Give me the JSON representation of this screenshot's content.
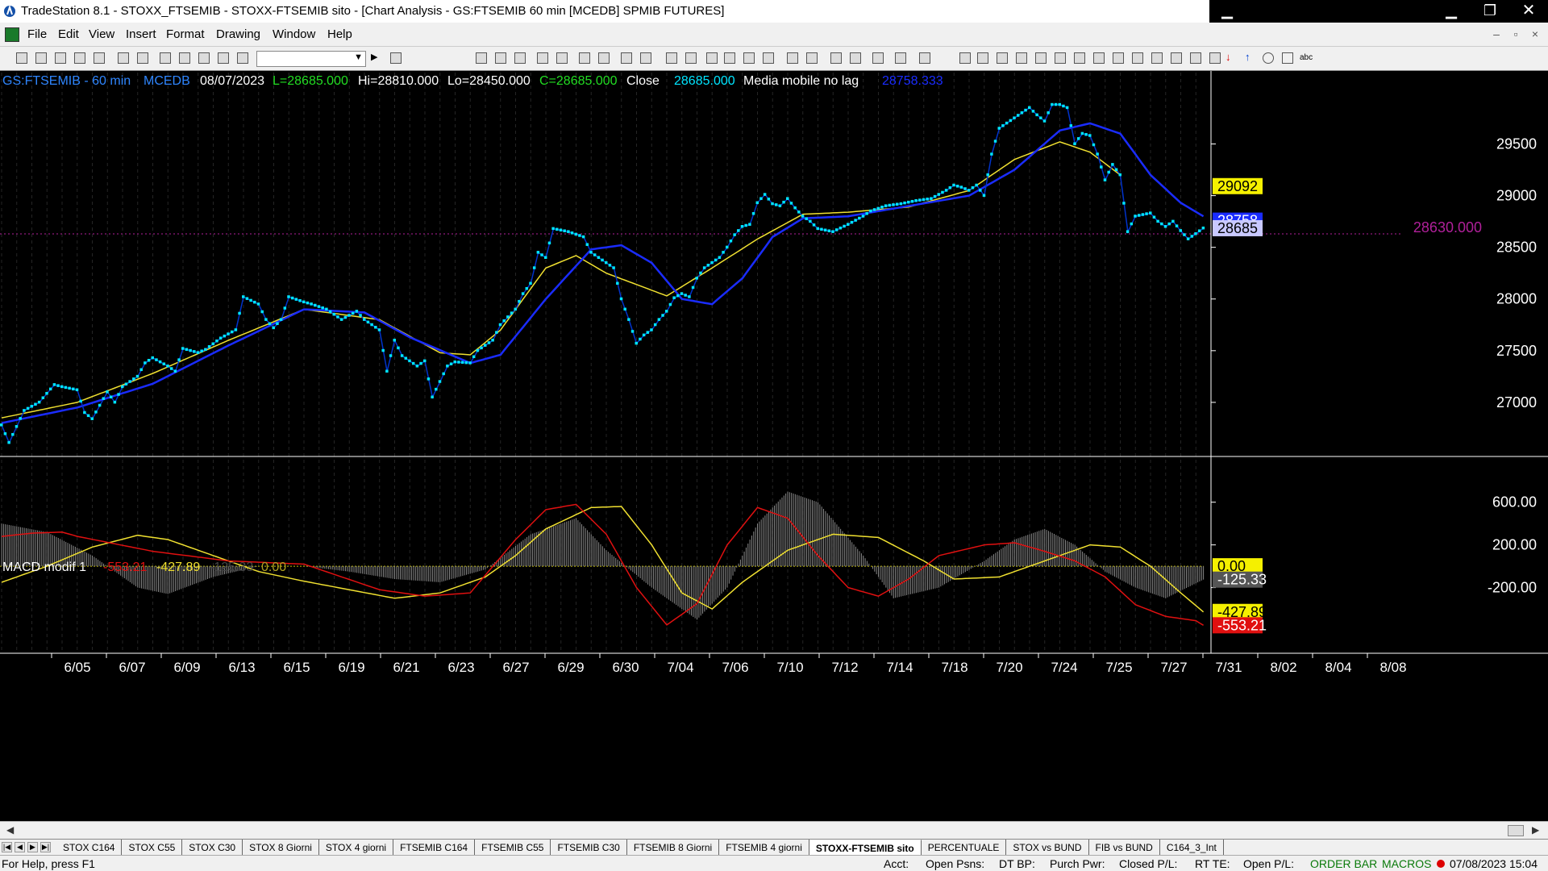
{
  "window": {
    "title": "TradeStation 8.1 - STOXX_FTSEMIB - STOXX-FTSEMIB sito - [Chart Analysis - GS:FTSEMIB  60 min  [MCEDB] SPMIB FUTURES]",
    "minimize": "▁",
    "restore": "❐",
    "close": "✕"
  },
  "menu": {
    "items": [
      "File",
      "Edit",
      "View",
      "Insert",
      "Format",
      "Drawing",
      "Window",
      "Help"
    ],
    "mdi_min": "–",
    "mdi_restore": "▫",
    "mdi_close": "×"
  },
  "colors": {
    "background": "#000000",
    "price_dots": "#00e5ff",
    "price_line": "#0033cc",
    "ma_yellow": "#f0e030",
    "ma_blue": "#1a2cff",
    "macd_red": "#e01010",
    "macd_yellow": "#f0e030",
    "histogram": "#8a8a8a",
    "grid_dash": "#6a6a6a",
    "axis_text": "#ffffff",
    "price_ref": "#b0209a"
  },
  "chart_header": {
    "symbol": "GS:FTSEMIB - 60 min",
    "feed": "MCEDB",
    "date": "08/07/2023",
    "last": "L=28685.000",
    "high": "Hi=28810.000",
    "low": "Lo=28450.000",
    "close_eq": "C=28685.000",
    "close_label": "Close",
    "close_value": "28685.000",
    "indicator_name": "Media mobile no lag",
    "indicator_value": "28758.333"
  },
  "macd_header": {
    "name": "MACD modif 1",
    "v1": "-553.21",
    "v2": "-427.89",
    "v3": "-125.33",
    "v4": "0.00"
  },
  "price_axis": {
    "ticks": [
      "29500",
      "29000",
      "28500",
      "28000",
      "27500",
      "27000"
    ],
    "label_29092": "29092",
    "label_28758": "28758",
    "label_28685": "28685",
    "ref_line_label": "28630.000"
  },
  "macd_axis": {
    "ticks": [
      "600.00",
      "200.00",
      "-200.00"
    ],
    "label_zero": "0.00",
    "label_hist": "-125.33",
    "label_signal": "-427.89",
    "label_macd": "-553.21"
  },
  "time_axis": {
    "labels": [
      "6/05",
      "6/07",
      "6/09",
      "6/13",
      "6/15",
      "6/19",
      "6/21",
      "6/23",
      "6/27",
      "6/29",
      "6/30",
      "7/04",
      "7/06",
      "7/10",
      "7/12",
      "7/14",
      "7/18",
      "7/20",
      "7/24",
      "7/25",
      "7/27",
      "7/31",
      "8/02",
      "8/04",
      "8/08"
    ]
  },
  "chart_data": {
    "type": "line",
    "price": [
      [
        0,
        26780
      ],
      [
        1,
        26610
      ],
      [
        3,
        26920
      ],
      [
        5,
        27000
      ],
      [
        7,
        27170
      ],
      [
        8,
        27150
      ],
      [
        10,
        27120
      ],
      [
        11,
        26900
      ],
      [
        12,
        26840
      ],
      [
        14,
        27100
      ],
      [
        15,
        27000
      ],
      [
        16,
        27150
      ],
      [
        18,
        27250
      ],
      [
        19,
        27380
      ],
      [
        20,
        27430
      ],
      [
        22,
        27350
      ],
      [
        23,
        27300
      ],
      [
        24,
        27520
      ],
      [
        26,
        27480
      ],
      [
        27,
        27510
      ],
      [
        29,
        27620
      ],
      [
        31,
        27700
      ],
      [
        32,
        28020
      ],
      [
        34,
        27950
      ],
      [
        35,
        27800
      ],
      [
        36,
        27720
      ],
      [
        37,
        27800
      ],
      [
        38,
        28020
      ],
      [
        40,
        27970
      ],
      [
        41,
        27950
      ],
      [
        43,
        27900
      ],
      [
        45,
        27800
      ],
      [
        47,
        27880
      ],
      [
        48,
        27800
      ],
      [
        50,
        27700
      ],
      [
        51,
        27300
      ],
      [
        52,
        27600
      ],
      [
        53,
        27450
      ],
      [
        55,
        27350
      ],
      [
        56,
        27400
      ],
      [
        57,
        27050
      ],
      [
        58,
        27200
      ],
      [
        59,
        27350
      ],
      [
        60,
        27390
      ],
      [
        62,
        27380
      ],
      [
        63,
        27500
      ],
      [
        65,
        27600
      ],
      [
        66,
        27750
      ],
      [
        68,
        27900
      ],
      [
        69,
        28050
      ],
      [
        70,
        28150
      ],
      [
        71,
        28450
      ],
      [
        72,
        28400
      ],
      [
        73,
        28680
      ],
      [
        75,
        28650
      ],
      [
        77,
        28600
      ],
      [
        78,
        28450
      ],
      [
        79,
        28400
      ],
      [
        81,
        28300
      ],
      [
        82,
        28000
      ],
      [
        83,
        27800
      ],
      [
        84,
        27570
      ],
      [
        85,
        27650
      ],
      [
        86,
        27700
      ],
      [
        87,
        27800
      ],
      [
        88,
        27880
      ],
      [
        89,
        28010
      ],
      [
        90,
        28050
      ],
      [
        91,
        28020
      ],
      [
        92,
        28200
      ],
      [
        93,
        28300
      ],
      [
        95,
        28400
      ],
      [
        96,
        28500
      ],
      [
        97,
        28620
      ],
      [
        98,
        28700
      ],
      [
        99,
        28720
      ],
      [
        100,
        28930
      ],
      [
        101,
        29010
      ],
      [
        102,
        28920
      ],
      [
        103,
        28900
      ],
      [
        104,
        28970
      ],
      [
        105,
        28880
      ],
      [
        106,
        28800
      ],
      [
        107,
        28750
      ],
      [
        108,
        28680
      ],
      [
        110,
        28650
      ],
      [
        112,
        28720
      ],
      [
        114,
        28800
      ],
      [
        115,
        28850
      ],
      [
        117,
        28900
      ],
      [
        119,
        28920
      ],
      [
        121,
        28950
      ],
      [
        123,
        28970
      ],
      [
        125,
        29050
      ],
      [
        126,
        29100
      ],
      [
        127,
        29080
      ],
      [
        128,
        29050
      ],
      [
        129,
        29100
      ],
      [
        130,
        29000
      ],
      [
        131,
        29400
      ],
      [
        132,
        29650
      ],
      [
        133,
        29700
      ],
      [
        135,
        29800
      ],
      [
        136,
        29850
      ],
      [
        137,
        29780
      ],
      [
        138,
        29720
      ],
      [
        139,
        29880
      ],
      [
        140,
        29880
      ],
      [
        141,
        29850
      ],
      [
        142,
        29500
      ],
      [
        143,
        29600
      ],
      [
        144,
        29580
      ],
      [
        145,
        29400
      ],
      [
        146,
        29150
      ],
      [
        147,
        29300
      ],
      [
        148,
        29200
      ],
      [
        149,
        28650
      ],
      [
        150,
        28800
      ],
      [
        152,
        28830
      ],
      [
        153,
        28750
      ],
      [
        154,
        28700
      ],
      [
        155,
        28750
      ],
      [
        156,
        28660
      ],
      [
        157,
        28580
      ],
      [
        158,
        28630
      ],
      [
        159,
        28685
      ]
    ],
    "ma_yellow": [
      [
        0,
        26850
      ],
      [
        10,
        27000
      ],
      [
        20,
        27280
      ],
      [
        30,
        27600
      ],
      [
        40,
        27900
      ],
      [
        50,
        27800
      ],
      [
        58,
        27480
      ],
      [
        62,
        27460
      ],
      [
        66,
        27700
      ],
      [
        72,
        28300
      ],
      [
        76,
        28420
      ],
      [
        80,
        28250
      ],
      [
        88,
        28030
      ],
      [
        94,
        28300
      ],
      [
        100,
        28580
      ],
      [
        106,
        28820
      ],
      [
        112,
        28840
      ],
      [
        120,
        28890
      ],
      [
        128,
        29050
      ],
      [
        134,
        29350
      ],
      [
        140,
        29520
      ],
      [
        144,
        29420
      ],
      [
        148,
        29200
      ]
    ],
    "ma_blue": [
      [
        0,
        26800
      ],
      [
        10,
        26950
      ],
      [
        20,
        27180
      ],
      [
        30,
        27550
      ],
      [
        40,
        27900
      ],
      [
        48,
        27870
      ],
      [
        54,
        27630
      ],
      [
        62,
        27380
      ],
      [
        66,
        27460
      ],
      [
        72,
        28000
      ],
      [
        78,
        28480
      ],
      [
        82,
        28520
      ],
      [
        86,
        28350
      ],
      [
        90,
        28000
      ],
      [
        94,
        27950
      ],
      [
        98,
        28200
      ],
      [
        102,
        28600
      ],
      [
        106,
        28780
      ],
      [
        112,
        28800
      ],
      [
        120,
        28900
      ],
      [
        128,
        29000
      ],
      [
        134,
        29250
      ],
      [
        140,
        29630
      ],
      [
        144,
        29700
      ],
      [
        148,
        29600
      ],
      [
        152,
        29200
      ],
      [
        156,
        28930
      ],
      [
        159,
        28800
      ]
    ],
    "macd_red": [
      [
        0,
        280
      ],
      [
        4,
        310
      ],
      [
        8,
        320
      ],
      [
        10,
        280
      ],
      [
        20,
        140
      ],
      [
        30,
        50
      ],
      [
        40,
        20
      ],
      [
        50,
        -220
      ],
      [
        56,
        -280
      ],
      [
        62,
        -250
      ],
      [
        68,
        250
      ],
      [
        72,
        530
      ],
      [
        76,
        580
      ],
      [
        80,
        300
      ],
      [
        84,
        -200
      ],
      [
        88,
        -550
      ],
      [
        92,
        -350
      ],
      [
        96,
        200
      ],
      [
        100,
        550
      ],
      [
        104,
        450
      ],
      [
        108,
        100
      ],
      [
        112,
        -200
      ],
      [
        116,
        -280
      ],
      [
        120,
        -120
      ],
      [
        124,
        100
      ],
      [
        130,
        200
      ],
      [
        134,
        220
      ],
      [
        138,
        140
      ],
      [
        142,
        50
      ],
      [
        146,
        -100
      ],
      [
        150,
        -360
      ],
      [
        154,
        -470
      ],
      [
        158,
        -510
      ],
      [
        159,
        -553
      ]
    ],
    "macd_yellow": [
      [
        0,
        -150
      ],
      [
        6,
        0
      ],
      [
        12,
        180
      ],
      [
        18,
        290
      ],
      [
        22,
        250
      ],
      [
        28,
        100
      ],
      [
        34,
        -50
      ],
      [
        40,
        -140
      ],
      [
        46,
        -220
      ],
      [
        52,
        -300
      ],
      [
        58,
        -250
      ],
      [
        64,
        -100
      ],
      [
        68,
        100
      ],
      [
        72,
        350
      ],
      [
        78,
        550
      ],
      [
        82,
        560
      ],
      [
        86,
        200
      ],
      [
        90,
        -250
      ],
      [
        94,
        -400
      ],
      [
        98,
        -150
      ],
      [
        104,
        150
      ],
      [
        110,
        300
      ],
      [
        116,
        270
      ],
      [
        122,
        50
      ],
      [
        126,
        -120
      ],
      [
        132,
        -100
      ],
      [
        138,
        50
      ],
      [
        144,
        200
      ],
      [
        148,
        180
      ],
      [
        152,
        0
      ],
      [
        156,
        -250
      ],
      [
        159,
        -428
      ]
    ],
    "histogram": [
      [
        0,
        400
      ],
      [
        6,
        320
      ],
      [
        12,
        100
      ],
      [
        18,
        -200
      ],
      [
        22,
        -260
      ],
      [
        28,
        -100
      ],
      [
        34,
        0
      ],
      [
        40,
        0
      ],
      [
        46,
        -50
      ],
      [
        52,
        -120
      ],
      [
        58,
        -150
      ],
      [
        64,
        -30
      ],
      [
        70,
        300
      ],
      [
        76,
        450
      ],
      [
        80,
        150
      ],
      [
        86,
        -200
      ],
      [
        92,
        -500
      ],
      [
        96,
        -200
      ],
      [
        100,
        400
      ],
      [
        104,
        700
      ],
      [
        108,
        600
      ],
      [
        114,
        100
      ],
      [
        118,
        -300
      ],
      [
        124,
        -200
      ],
      [
        130,
        50
      ],
      [
        134,
        250
      ],
      [
        138,
        350
      ],
      [
        142,
        200
      ],
      [
        146,
        -50
      ],
      [
        150,
        -200
      ],
      [
        154,
        -300
      ],
      [
        159,
        -125
      ]
    ],
    "xlim": [
      0,
      160
    ],
    "ylim": [
      26500,
      30050
    ],
    "macd_ylim": [
      -800,
      900
    ]
  },
  "tabs": [
    "STOX C164",
    "STOX C55",
    "STOX  C30",
    "STOX  8 Giorni",
    "STOX 4 giorni",
    "FTSEMIB C164",
    "FTSEMIB C55",
    "FTSEMIB C30",
    "FTSEMIB  8 Giorni",
    "FTSEMIB  4 giorni",
    "STOXX-FTSEMIB sito",
    "PERCENTUALE",
    "STOX vs BUND",
    "FIB vs BUND",
    "C164_3_Int"
  ],
  "active_tab": "STOXX-FTSEMIB sito",
  "status": {
    "help": "For Help, press F1",
    "acct": "Acct:",
    "open_psns": "Open Psns:",
    "dt_bp": "DT BP:",
    "purch_pwr": "Purch Pwr:",
    "closed_pl": "Closed P/L:",
    "rt_te": "RT TE:",
    "open_pl": "Open P/L:",
    "order_bar": "ORDER BAR",
    "macros": "MACROS",
    "datetime": "07/08/2023 15:04"
  }
}
